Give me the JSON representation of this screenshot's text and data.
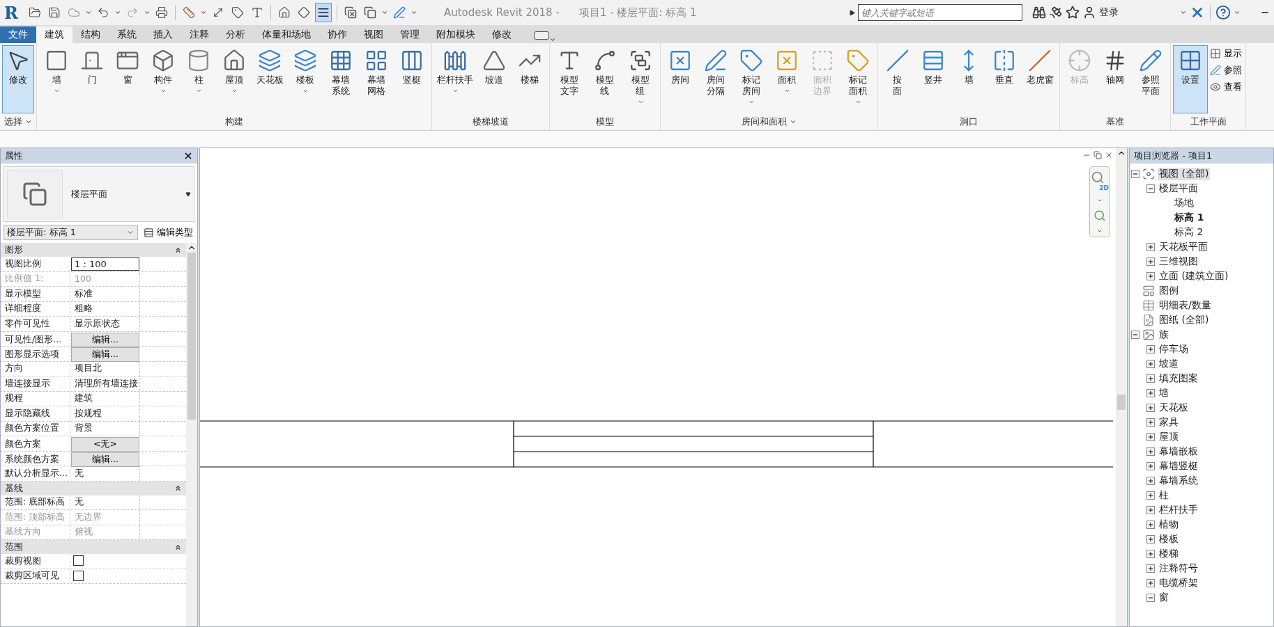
{
  "app": {
    "logo": "R",
    "title": "Autodesk Revit 2018 -",
    "document": "项目1 - 楼层平面: 标高 1",
    "thin_lines": {
      "on": true
    }
  },
  "search": {
    "placeholder": "键入关键字或短语"
  },
  "account": {
    "login": "登录"
  },
  "tabs": [
    {
      "label": "文件",
      "kind": "file",
      "selected": false
    },
    {
      "label": "建筑",
      "kind": "tab",
      "selected": true
    },
    {
      "label": "结构",
      "kind": "tab",
      "selected": false
    },
    {
      "label": "系统",
      "kind": "tab",
      "selected": false
    },
    {
      "label": "插入",
      "kind": "tab",
      "selected": false
    },
    {
      "label": "注释",
      "kind": "tab",
      "selected": false
    },
    {
      "label": "分析",
      "kind": "tab",
      "selected": false
    },
    {
      "label": "体量和场地",
      "kind": "tab",
      "selected": false
    },
    {
      "label": "协作",
      "kind": "tab",
      "selected": false
    },
    {
      "label": "视图",
      "kind": "tab",
      "selected": false
    },
    {
      "label": "管理",
      "kind": "tab",
      "selected": false
    },
    {
      "label": "附加模块",
      "kind": "tab",
      "selected": false
    },
    {
      "label": "修改",
      "kind": "tab",
      "selected": false
    }
  ],
  "ribbon": [
    {
      "title": "选择",
      "dropdown": true,
      "buttons": [
        {
          "label": "修改",
          "dropdown": false,
          "selected": true,
          "disabled": false
        }
      ]
    },
    {
      "title": "构建",
      "dropdown": false,
      "buttons": [
        {
          "label": "墙",
          "dropdown": true,
          "selected": false,
          "disabled": false
        },
        {
          "label": "门",
          "dropdown": false,
          "selected": false,
          "disabled": false
        },
        {
          "label": "窗",
          "dropdown": false,
          "selected": false,
          "disabled": false
        },
        {
          "label": "构件",
          "dropdown": true,
          "selected": false,
          "disabled": false
        },
        {
          "label": "柱",
          "dropdown": true,
          "selected": false,
          "disabled": false
        },
        {
          "label": "屋顶",
          "dropdown": true,
          "selected": false,
          "disabled": false
        },
        {
          "label": "天花板",
          "dropdown": false,
          "selected": false,
          "disabled": false
        },
        {
          "label": "楼板",
          "dropdown": true,
          "selected": false,
          "disabled": false
        },
        {
          "label": "幕墙系统",
          "two_line": true,
          "dropdown": false,
          "selected": false,
          "disabled": false
        },
        {
          "label": "幕墙网格",
          "two_line": true,
          "dropdown": false,
          "selected": false,
          "disabled": false
        },
        {
          "label": "竖梃",
          "dropdown": false,
          "selected": false,
          "disabled": false
        }
      ]
    },
    {
      "title": "楼梯坡道",
      "dropdown": false,
      "buttons": [
        {
          "label": "栏杆扶手",
          "dropdown": true,
          "selected": false,
          "disabled": false
        },
        {
          "label": "坡道",
          "dropdown": false,
          "selected": false,
          "disabled": false
        },
        {
          "label": "楼梯",
          "dropdown": false,
          "selected": false,
          "disabled": false
        }
      ]
    },
    {
      "title": "模型",
      "dropdown": false,
      "buttons": [
        {
          "label": "模型文字",
          "two_line": true,
          "dropdown": false,
          "selected": false,
          "disabled": false
        },
        {
          "label": "模型线",
          "two_line": true,
          "dropdown": false,
          "selected": false,
          "disabled": false
        },
        {
          "label": "模型组",
          "two_line": true,
          "dropdown": true,
          "selected": false,
          "disabled": false
        }
      ]
    },
    {
      "title": "房间和面积",
      "dropdown": true,
      "buttons": [
        {
          "label": "房间",
          "dropdown": false,
          "selected": false,
          "disabled": false
        },
        {
          "label": "房间分隔",
          "two_line": true,
          "dropdown": false,
          "selected": false,
          "disabled": false
        },
        {
          "label": "标记房间",
          "two_line": true,
          "dropdown": true,
          "selected": false,
          "disabled": false
        },
        {
          "label": "面积",
          "dropdown": true,
          "selected": false,
          "disabled": false
        },
        {
          "label": "面积边界",
          "two_line": true,
          "dropdown": false,
          "selected": false,
          "disabled": true
        },
        {
          "label": "标记面积",
          "two_line": true,
          "dropdown": true,
          "selected": false,
          "disabled": false
        }
      ]
    },
    {
      "title": "洞口",
      "dropdown": false,
      "buttons": [
        {
          "label": "按面",
          "two_line": true,
          "dropdown": false,
          "selected": false,
          "disabled": false
        },
        {
          "label": "竖井",
          "dropdown": false,
          "selected": false,
          "disabled": false
        },
        {
          "label": "墙",
          "dropdown": false,
          "selected": false,
          "disabled": false
        },
        {
          "label": "垂直",
          "dropdown": false,
          "selected": false,
          "disabled": false
        },
        {
          "label": "老虎窗",
          "dropdown": false,
          "selected": false,
          "disabled": false
        }
      ]
    },
    {
      "title": "基准",
      "dropdown": false,
      "buttons": [
        {
          "label": "标高",
          "dropdown": false,
          "selected": false,
          "disabled": true
        },
        {
          "label": "轴网",
          "dropdown": false,
          "selected": false,
          "disabled": false
        },
        {
          "label": "参照平面",
          "two_line": true,
          "dropdown": false,
          "selected": false,
          "disabled": false
        }
      ]
    },
    {
      "title": "工作平面",
      "dropdown": false,
      "buttons": [
        {
          "label": "设置",
          "dropdown": false,
          "selected": true,
          "disabled": false
        }
      ],
      "small_buttons": [
        {
          "label": "显示"
        },
        {
          "label": "参照"
        },
        {
          "label": "查看"
        }
      ]
    }
  ],
  "properties": {
    "title": "属性",
    "type_name": "楼层平面",
    "instance": "楼层平面: 标高 1",
    "edit_type": "编辑类型",
    "groups": [
      {
        "title": "图形",
        "rows": [
          {
            "name": "视图比例",
            "value": "1 : 100",
            "kind": "input",
            "disabled": false
          },
          {
            "name": "比例值 1:",
            "value": "100",
            "kind": "text",
            "disabled": true
          },
          {
            "name": "显示模型",
            "value": "标准",
            "kind": "text",
            "disabled": false
          },
          {
            "name": "详细程度",
            "value": "粗略",
            "kind": "text",
            "disabled": false
          },
          {
            "name": "零件可见性",
            "value": "显示原状态",
            "kind": "text",
            "disabled": false
          },
          {
            "name": "可见性/图形...",
            "value": "编辑...",
            "kind": "button",
            "disabled": false
          },
          {
            "name": "图形显示选项",
            "value": "编辑...",
            "kind": "button",
            "disabled": false
          },
          {
            "name": "方向",
            "value": "项目北",
            "kind": "text",
            "disabled": false
          },
          {
            "name": "墙连接显示",
            "value": "清理所有墙连接",
            "kind": "text",
            "disabled": false
          },
          {
            "name": "规程",
            "value": "建筑",
            "kind": "text",
            "disabled": false
          },
          {
            "name": "显示隐藏线",
            "value": "按规程",
            "kind": "text",
            "disabled": false
          },
          {
            "name": "颜色方案位置",
            "value": "背景",
            "kind": "text",
            "disabled": false
          },
          {
            "name": "颜色方案",
            "value": "<无>",
            "kind": "button",
            "disabled": false
          },
          {
            "name": "系统颜色方案",
            "value": "编辑...",
            "kind": "button",
            "disabled": false
          },
          {
            "name": "默认分析显示...",
            "value": "无",
            "kind": "text",
            "disabled": false
          }
        ]
      },
      {
        "title": "基线",
        "rows": [
          {
            "name": "范围: 底部标高",
            "value": "无",
            "kind": "text",
            "disabled": false
          },
          {
            "name": "范围: 顶部标高",
            "value": "无边界",
            "kind": "text",
            "disabled": true
          },
          {
            "name": "基线方向",
            "value": "俯视",
            "kind": "text",
            "disabled": true
          }
        ]
      },
      {
        "title": "范围",
        "rows": [
          {
            "name": "裁剪视图",
            "kind": "checkbox",
            "checked": false,
            "disabled": false
          },
          {
            "name": "裁剪区域可见",
            "kind": "checkbox",
            "checked": false,
            "disabled": false
          }
        ]
      }
    ]
  },
  "browser": {
    "title": "项目浏览器 - 项目1",
    "tree": [
      {
        "label": "视图 (全部)",
        "expanded": true,
        "selected": true,
        "active": false,
        "children": [
          {
            "label": "楼层平面",
            "expanded": true,
            "selected": false,
            "active": false,
            "children": [
              {
                "label": "场地",
                "selected": false,
                "active": false
              },
              {
                "label": "标高 1",
                "selected": false,
                "active": true
              },
              {
                "label": "标高 2",
                "selected": false,
                "active": false
              }
            ]
          },
          {
            "label": "天花板平面",
            "expanded": false,
            "selected": false,
            "active": false
          },
          {
            "label": "三维视图",
            "expanded": false,
            "selected": false,
            "active": false
          },
          {
            "label": "立面 (建筑立面)",
            "expanded": false,
            "selected": false,
            "active": false
          }
        ]
      },
      {
        "label": "图例",
        "selected": false,
        "active": false
      },
      {
        "label": "明细表/数量",
        "selected": false,
        "active": false
      },
      {
        "label": "图纸 (全部)",
        "selected": false,
        "active": false
      },
      {
        "label": "族",
        "expanded": true,
        "selected": false,
        "active": false,
        "children": [
          {
            "label": "停车场",
            "expanded": false,
            "selected": false,
            "active": false
          },
          {
            "label": "坡道",
            "expanded": false,
            "selected": false,
            "active": false
          },
          {
            "label": "填充图案",
            "expanded": false,
            "selected": false,
            "active": false
          },
          {
            "label": "墙",
            "expanded": false,
            "selected": false,
            "active": false
          },
          {
            "label": "天花板",
            "expanded": false,
            "selected": false,
            "active": false
          },
          {
            "label": "家具",
            "expanded": false,
            "selected": false,
            "active": false
          },
          {
            "label": "屋顶",
            "expanded": false,
            "selected": false,
            "active": false
          },
          {
            "label": "幕墙嵌板",
            "expanded": false,
            "selected": false,
            "active": false
          },
          {
            "label": "幕墙竖梃",
            "expanded": false,
            "selected": false,
            "active": false
          },
          {
            "label": "幕墙系统",
            "expanded": false,
            "selected": false,
            "active": false
          },
          {
            "label": "柱",
            "expanded": false,
            "selected": false,
            "active": false
          },
          {
            "label": "栏杆扶手",
            "expanded": false,
            "selected": false,
            "active": false
          },
          {
            "label": "植物",
            "expanded": false,
            "selected": false,
            "active": false
          },
          {
            "label": "楼板",
            "expanded": false,
            "selected": false,
            "active": false
          },
          {
            "label": "楼梯",
            "expanded": false,
            "selected": false,
            "active": false
          },
          {
            "label": "注释符号",
            "expanded": false,
            "selected": false,
            "active": false
          },
          {
            "label": "电缆桥架",
            "expanded": false,
            "selected": false,
            "active": false
          },
          {
            "label": "窗",
            "expanded": true,
            "selected": false,
            "active": false
          }
        ]
      }
    ]
  },
  "navigation": {
    "badge": "2D"
  }
}
